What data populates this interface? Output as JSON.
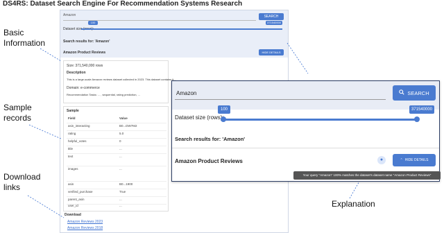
{
  "title": "DS4RS: Dataset Search Engine For Recommendation Systems Research",
  "labels": {
    "basic_information": "Basic Information",
    "sample_records": "Sample records",
    "download_links": "Download links",
    "explanation": "Explanation"
  },
  "bg_app": {
    "search_value": "Amazon",
    "search_button": "SEARCH",
    "dataset_size_label": "Dataset size (rows):",
    "slider_min": "100",
    "slider_max": "371540000",
    "results_for": "Search results for: 'Amazon'",
    "item_title": "Amazon Product Reviews",
    "details_button": "HIDE DETAILS",
    "info": {
      "size": "Size: 371,540,000 rows",
      "description_heading": "Description",
      "description_text": "This is a large-scale Amazon reviews dataset collected in 2023. This dataset contains it...",
      "domain": "Domain: e-commerce",
      "rec_tasks": "Recommendation Tasks: ... , sequential, rating prediction, ..."
    },
    "sample_heading": "Sample",
    "table_headers": [
      "Field",
      "Value"
    ],
    "table_rows": [
      [
        "asin_interacting",
        "B0...DW7M2"
      ],
      [
        "rating",
        "5.0"
      ],
      [
        "helpful_votes",
        "0"
      ],
      [
        "title",
        "..."
      ],
      [
        "text",
        "..."
      ],
      [
        "images",
        "..."
      ],
      [
        "asin",
        "B0...1900"
      ],
      [
        "verified_purchase",
        "True"
      ],
      [
        "parent_asin",
        "..."
      ],
      [
        "user_id",
        "..."
      ]
    ],
    "download_heading": "Download",
    "download_links": [
      "Amazon Reviews 2023",
      "Amazon Reviews 2018"
    ]
  },
  "fg_app": {
    "search_value": "Amazon",
    "search_button": "SEARCH",
    "dataset_size_label": "Dataset size (rows):",
    "slider_min": "100",
    "slider_max": "371540000",
    "results_for": "Search results for: 'Amazon'",
    "item_title": "Amazon Product Reviews",
    "details_button": "HIDE DETAILS",
    "tooltip": "Your query \"Amazon\" 100% matches the dataset's dataset name \"Amazon Product Reviews\""
  },
  "colors": {
    "accent": "#4a7bd0",
    "header_bg": "#e8ecf5",
    "tooltip_bg": "#555555"
  },
  "icons": {
    "search": "search-icon",
    "chevron": "chevron-up-icon",
    "badge": "shield-icon"
  }
}
